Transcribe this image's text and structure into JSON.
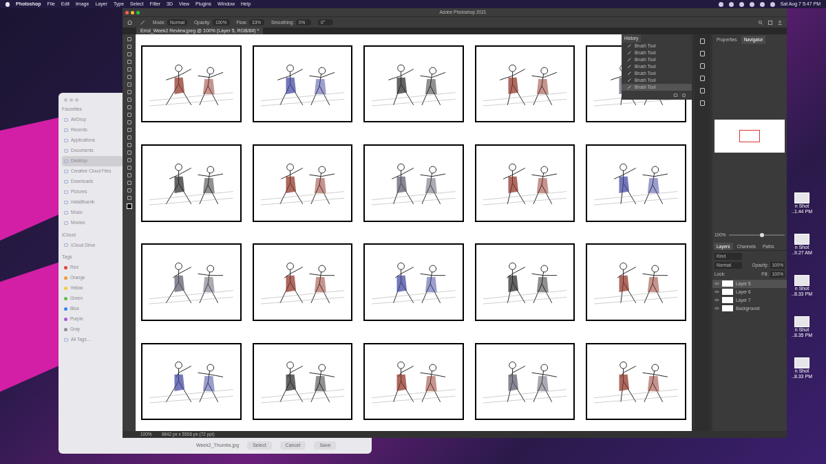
{
  "menu_bar": {
    "app": "Photoshop",
    "items": [
      "File",
      "Edit",
      "Image",
      "Layer",
      "Type",
      "Select",
      "Filter",
      "3D",
      "View",
      "Plugins",
      "Window",
      "Help"
    ],
    "clock": "Sat Aug 7  5:47 PM"
  },
  "finder": {
    "sections": [
      {
        "title": "Favorites",
        "items": [
          {
            "label": "AirDrop",
            "selected": false
          },
          {
            "label": "Recents",
            "selected": false
          },
          {
            "label": "Applications",
            "selected": false
          },
          {
            "label": "Documents",
            "selected": false
          },
          {
            "label": "Desktop",
            "selected": true
          },
          {
            "label": "Creative Cloud Files",
            "selected": false
          },
          {
            "label": "Downloads",
            "selected": false
          },
          {
            "label": "Pictures",
            "selected": false
          },
          {
            "label": "installbuenk",
            "selected": false
          },
          {
            "label": "Music",
            "selected": false
          },
          {
            "label": "Movies",
            "selected": false
          }
        ]
      },
      {
        "title": "iCloud",
        "items": [
          {
            "label": "iCloud Drive",
            "selected": false
          }
        ]
      },
      {
        "title": "Tags",
        "items": [
          {
            "label": "Red",
            "color": "#e0443e",
            "selected": false
          },
          {
            "label": "Orange",
            "color": "#f09a37",
            "selected": false
          },
          {
            "label": "Yellow",
            "color": "#f2cd3a",
            "selected": false
          },
          {
            "label": "Green",
            "color": "#5fbf4a",
            "selected": false
          },
          {
            "label": "Blue",
            "color": "#3a82f7",
            "selected": false
          },
          {
            "label": "Purple",
            "color": "#a55ad0",
            "selected": false
          },
          {
            "label": "Gray",
            "color": "#8e8e93",
            "selected": false
          },
          {
            "label": "All Tags…",
            "selected": false
          }
        ]
      }
    ],
    "files": [
      "Week2_Thumbs.jpg"
    ],
    "buttons": [
      "Select",
      "Cancel",
      "Save"
    ]
  },
  "desktop_files": [
    {
      "line1": "n Shot",
      "line2": "..1.44 PM"
    },
    {
      "line1": "n Shot",
      "line2": "..9.27 AM"
    },
    {
      "line1": "n Shot",
      "line2": "..8.33 PM"
    },
    {
      "line1": "n Shot",
      "line2": "..8.35 PM"
    },
    {
      "line1": "n Shot",
      "line2": "..8.33 PM"
    }
  ],
  "photoshop": {
    "title": "Adobe Photoshop 2021",
    "options": [
      {
        "label": "Mode:",
        "value": "Normal"
      },
      {
        "label": "Opacity:",
        "value": "100%"
      },
      {
        "label": "Flow:",
        "value": "33%"
      },
      {
        "label": "Smoothing:",
        "value": "0%"
      },
      {
        "value": "0°"
      }
    ],
    "document_tab": "Errol_Week2 Review.jpeg @ 100% (Layer 5, RGB/8#) *",
    "history": {
      "title": "History",
      "items": [
        {
          "label": "Brush Tool",
          "selected": false
        },
        {
          "label": "Brush Tool",
          "selected": false
        },
        {
          "label": "Brush Tool",
          "selected": false
        },
        {
          "label": "Brush Tool",
          "selected": false
        },
        {
          "label": "Brush Tool",
          "selected": false
        },
        {
          "label": "Brush Tool",
          "selected": false
        },
        {
          "label": "Brush Tool",
          "selected": true
        }
      ]
    },
    "navigator": {
      "tabs": [
        {
          "label": "Properties",
          "selected": false
        },
        {
          "label": "Navigator",
          "selected": true
        }
      ],
      "zoom": "100%",
      "level": 0.6
    },
    "layers": {
      "tabs": [
        {
          "label": "Layers",
          "selected": true
        },
        {
          "label": "Channels",
          "selected": false
        },
        {
          "label": "Paths",
          "selected": false
        }
      ],
      "filter": "Kind",
      "blend_mode": "Normal",
      "opacity_label": "Opacity:",
      "opacity": "100%",
      "lock_label": "Lock:",
      "fill_label": "Fill:",
      "fill": "100%",
      "items": [
        {
          "name": "Layer 5",
          "selected": true
        },
        {
          "name": "Layer 6",
          "selected": false
        },
        {
          "name": "Layer 7",
          "selected": false
        },
        {
          "name": "Background",
          "selected": false
        }
      ]
    },
    "status": {
      "zoom": "100%",
      "size": "9842 px x 5506 px (72 ppi)"
    }
  }
}
